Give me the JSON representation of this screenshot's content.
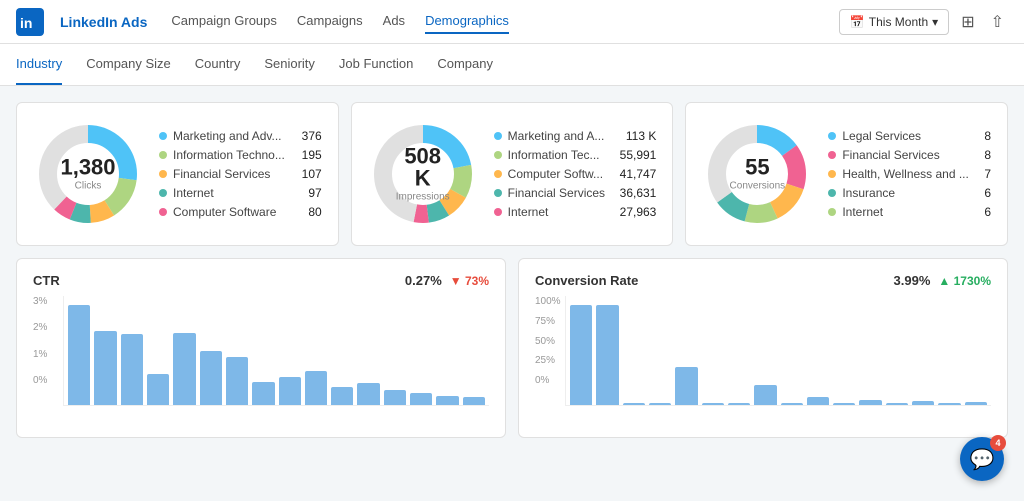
{
  "app": {
    "logo_text": "in",
    "title": "LinkedIn Ads"
  },
  "top_nav": {
    "links": [
      {
        "label": "Campaign Groups",
        "active": false
      },
      {
        "label": "Campaigns",
        "active": false
      },
      {
        "label": "Ads",
        "active": false
      },
      {
        "label": "Demographics",
        "active": true
      }
    ],
    "date_button": "This Month",
    "date_icon": "📅"
  },
  "sub_nav": {
    "links": [
      {
        "label": "Industry",
        "active": true
      },
      {
        "label": "Company Size",
        "active": false
      },
      {
        "label": "Country",
        "active": false
      },
      {
        "label": "Seniority",
        "active": false
      },
      {
        "label": "Job Function",
        "active": false
      },
      {
        "label": "Company",
        "active": false
      }
    ]
  },
  "donut_cards": [
    {
      "id": "clicks",
      "value": "1,380",
      "sub_label": "Clicks",
      "segments": [
        {
          "color": "#4fc3f7",
          "pct": 27
        },
        {
          "color": "#aed581",
          "pct": 14
        },
        {
          "color": "#ffb74d",
          "pct": 8
        },
        {
          "color": "#4db6ac",
          "pct": 7
        },
        {
          "color": "#f06292",
          "pct": 6
        },
        {
          "color": "#e0e0e0",
          "pct": 38
        }
      ],
      "legend": [
        {
          "color": "#4fc3f7",
          "name": "Marketing and Adv...",
          "value": "376"
        },
        {
          "color": "#aed581",
          "name": "Information Techno...",
          "value": "195"
        },
        {
          "color": "#ffb74d",
          "name": "Financial Services",
          "value": "107"
        },
        {
          "color": "#4db6ac",
          "name": "Internet",
          "value": "97"
        },
        {
          "color": "#f06292",
          "name": "Computer Software",
          "value": "80"
        }
      ]
    },
    {
      "id": "impressions",
      "value": "508 K",
      "sub_label": "Impressions",
      "segments": [
        {
          "color": "#4fc3f7",
          "pct": 22
        },
        {
          "color": "#aed581",
          "pct": 11
        },
        {
          "color": "#ffb74d",
          "pct": 8
        },
        {
          "color": "#4db6ac",
          "pct": 7
        },
        {
          "color": "#f06292",
          "pct": 5
        },
        {
          "color": "#e0e0e0",
          "pct": 47
        }
      ],
      "legend": [
        {
          "color": "#4fc3f7",
          "name": "Marketing and A...",
          "value": "113 K"
        },
        {
          "color": "#aed581",
          "name": "Information Tec...",
          "value": "55,991"
        },
        {
          "color": "#ffb74d",
          "name": "Computer Softw...",
          "value": "41,747"
        },
        {
          "color": "#4db6ac",
          "name": "Financial Services",
          "value": "36,631"
        },
        {
          "color": "#f06292",
          "name": "Internet",
          "value": "27,963"
        }
      ]
    },
    {
      "id": "conversions",
      "value": "55",
      "sub_label": "Conversions",
      "segments": [
        {
          "color": "#4fc3f7",
          "pct": 15
        },
        {
          "color": "#f06292",
          "pct": 15
        },
        {
          "color": "#ffb74d",
          "pct": 13
        },
        {
          "color": "#aed581",
          "pct": 11
        },
        {
          "color": "#4db6ac",
          "pct": 11
        },
        {
          "color": "#e0e0e0",
          "pct": 35
        }
      ],
      "legend": [
        {
          "color": "#4fc3f7",
          "name": "Legal Services",
          "value": "8"
        },
        {
          "color": "#f06292",
          "name": "Financial Services",
          "value": "8"
        },
        {
          "color": "#ffb74d",
          "name": "Health, Wellness and ...",
          "value": "7"
        },
        {
          "color": "#4db6ac",
          "name": "Insurance",
          "value": "6"
        },
        {
          "color": "#aed581",
          "name": "Internet",
          "value": "6"
        }
      ]
    }
  ],
  "bar_charts": [
    {
      "id": "ctr",
      "title": "CTR",
      "stat_main": "0.27%",
      "stat_change": "73%",
      "stat_direction": "down",
      "y_labels": [
        "3%",
        "2%",
        "1%",
        "0%"
      ],
      "bars": [
        65,
        48,
        46,
        20,
        47,
        35,
        31,
        15,
        18,
        22,
        12,
        14,
        10,
        8,
        6,
        5
      ]
    },
    {
      "id": "conversion_rate",
      "title": "Conversion Rate",
      "stat_main": "3.99%",
      "stat_change": "1730%",
      "stat_direction": "up",
      "y_labels": [
        "100%",
        "75%",
        "50%",
        "25%",
        "0%"
      ],
      "bars": [
        100,
        100,
        0,
        0,
        38,
        0,
        0,
        20,
        0,
        8,
        0,
        5,
        0,
        4,
        0,
        3
      ]
    }
  ],
  "chat": {
    "badge": "4"
  }
}
